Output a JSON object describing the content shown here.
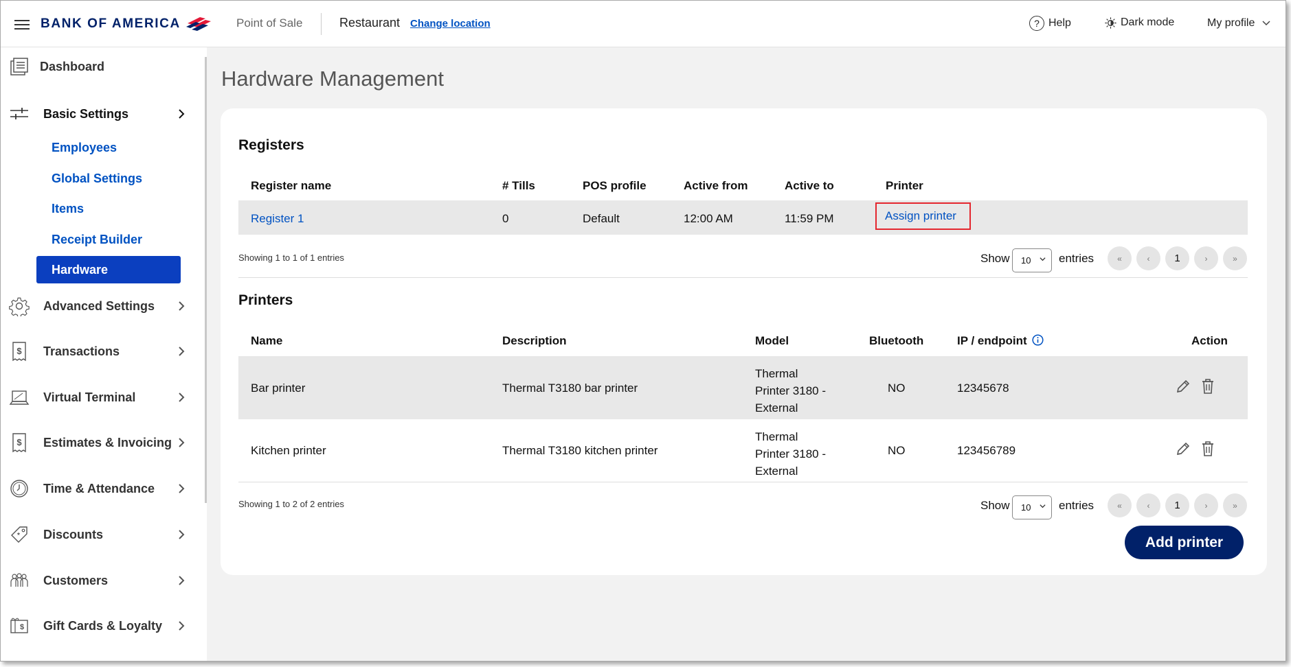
{
  "header": {
    "brand": "BANK OF AMERICA",
    "app_name": "Point of Sale",
    "location": "Restaurant",
    "change_location": "Change location",
    "help": "Help",
    "dark_mode": "Dark mode",
    "profile": "My profile",
    "brand_color": "#012169",
    "accent_red": "#e31837"
  },
  "sidebar": {
    "items": [
      {
        "label": "Dashboard",
        "icon": "dashboard-icon"
      },
      {
        "label": "Basic Settings",
        "icon": "sliders-icon"
      },
      {
        "label": "Advanced Settings",
        "icon": "gear-icon"
      },
      {
        "label": "Transactions",
        "icon": "dollar-receipt-icon"
      },
      {
        "label": "Virtual Terminal",
        "icon": "laptop-icon"
      },
      {
        "label": "Estimates & Invoicing",
        "icon": "invoice-icon"
      },
      {
        "label": "Time & Attendance",
        "icon": "clock-icon"
      },
      {
        "label": "Discounts",
        "icon": "tag-icon"
      },
      {
        "label": "Customers",
        "icon": "people-icon"
      },
      {
        "label": "Gift Cards & Loyalty",
        "icon": "gift-card-icon"
      }
    ],
    "submenu": [
      "Employees",
      "Global Settings",
      "Items",
      "Receipt Builder",
      "Hardware"
    ],
    "active_submenu": "Hardware"
  },
  "page": {
    "title": "Hardware Management"
  },
  "registers": {
    "title": "Registers",
    "headers": [
      "Register name",
      "# Tills",
      "POS profile",
      "Active from",
      "Active to",
      "Printer"
    ],
    "rows": [
      {
        "name": "Register 1",
        "tills": "0",
        "profile": "Default",
        "from": "12:00 AM",
        "to": "11:59 PM",
        "printer": "Assign printer"
      }
    ],
    "info": "Showing 1 to 1 of 1 entries",
    "show_label": "Show",
    "entries_label": "entries",
    "page_size": "10",
    "pagination": {
      "first": "«",
      "prev": "‹",
      "page": "1",
      "next": "›",
      "last": "»"
    }
  },
  "printers": {
    "title": "Printers",
    "headers": [
      "Name",
      "Description",
      "Model",
      "Bluetooth",
      "IP / endpoint",
      "Action"
    ],
    "rows": [
      {
        "name": "Bar printer",
        "description": "Thermal T3180 bar printer",
        "model": [
          "Thermal",
          "Printer 3180 -",
          "External"
        ],
        "bluetooth": "NO",
        "ip": "12345678"
      },
      {
        "name": "Kitchen printer",
        "description": "Thermal T3180 kitchen printer",
        "model": [
          "Thermal",
          "Printer 3180 -",
          "External"
        ],
        "bluetooth": "NO",
        "ip": "123456789"
      }
    ],
    "info": "Showing 1 to 2 of 2 entries",
    "show_label": "Show",
    "entries_label": "entries",
    "page_size": "10",
    "pagination": {
      "first": "«",
      "prev": "‹",
      "page": "1",
      "next": "›",
      "last": "»"
    },
    "add_button": "Add printer"
  }
}
